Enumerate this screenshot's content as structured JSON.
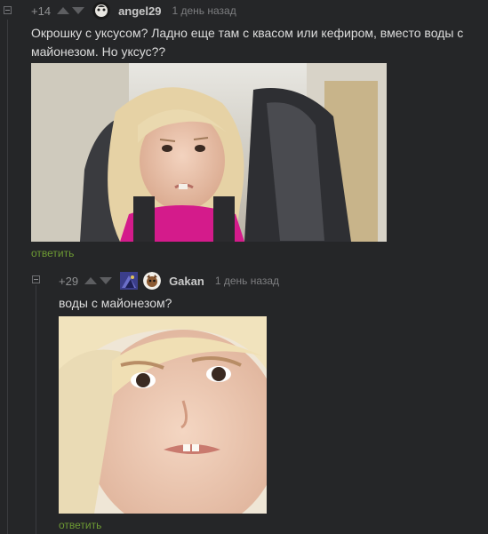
{
  "comment1": {
    "rating": "+14",
    "username": "angel29",
    "time": "1 день назад",
    "text": "Окрошку с уксусом? Ладно еще там с квасом или кефиром, вместо воды с майонезом. Но уксус??",
    "reply_label": "ответить"
  },
  "comment2": {
    "rating": "+29",
    "username": "Gakan",
    "time": "1 день назад",
    "text": "воды с майонезом?",
    "reply_label": "ответить"
  },
  "colors": {
    "background": "#252628",
    "reply_link": "#6d9a33"
  }
}
